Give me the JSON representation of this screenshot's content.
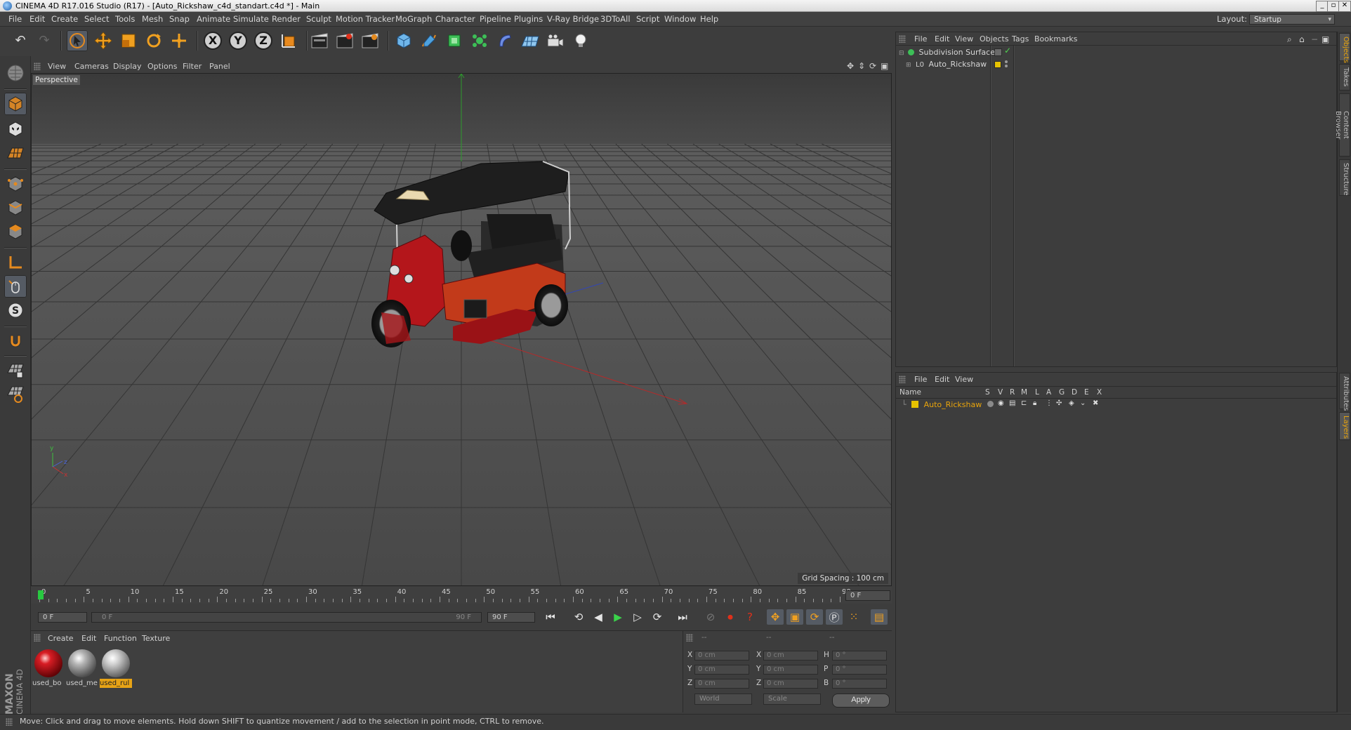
{
  "window": {
    "title": "CINEMA 4D R17.016 Studio (R17) - [Auto_Rickshaw_c4d_standart.c4d *] - Main"
  },
  "menubar": {
    "items": [
      "File",
      "Edit",
      "Create",
      "Select",
      "Tools",
      "Mesh",
      "Snap",
      "Animate",
      "Simulate",
      "Render",
      "Sculpt",
      "Motion Tracker",
      "MoGraph",
      "Character",
      "Pipeline",
      "Plugins",
      "V-Ray Bridge",
      "3DToAll",
      "Script",
      "Window",
      "Help"
    ],
    "layout_label": "Layout:",
    "layout_value": "Startup"
  },
  "viewport": {
    "menu": [
      "View",
      "Cameras",
      "Display",
      "Options",
      "Filter",
      "Panel"
    ],
    "label": "Perspective",
    "grid_spacing": "Grid Spacing : 100 cm"
  },
  "timeline": {
    "ticks": [
      "0",
      "5",
      "10",
      "15",
      "20",
      "25",
      "30",
      "35",
      "40",
      "45",
      "50",
      "55",
      "60",
      "65",
      "70",
      "75",
      "80",
      "85",
      "90"
    ],
    "current_frame": "0 F",
    "start_frame": "0 F",
    "range_start": "0 F",
    "range_end": "90 F",
    "end_frame": "90 F"
  },
  "materials": {
    "menu": [
      "Create",
      "Edit",
      "Function",
      "Texture"
    ],
    "items": [
      {
        "label": "used_bo",
        "color": "#c8141a",
        "selected": false
      },
      {
        "label": "used_me",
        "color": "#9a9a9a",
        "selected": false
      },
      {
        "label": "used_rul",
        "color": "#b5b5b5",
        "selected": true
      }
    ]
  },
  "coords": {
    "header": [
      "--",
      "--",
      "--"
    ],
    "rows": [
      {
        "l1": "X",
        "v1": "0 cm",
        "l2": "X",
        "v2": "0 cm",
        "l3": "H",
        "v3": "0 °"
      },
      {
        "l1": "Y",
        "v1": "0 cm",
        "l2": "Y",
        "v2": "0 cm",
        "l3": "P",
        "v3": "0 °"
      },
      {
        "l1": "Z",
        "v1": "0 cm",
        "l2": "Z",
        "v2": "0 cm",
        "l3": "B",
        "v3": "0 °"
      }
    ],
    "space": "World",
    "mode": "Scale",
    "apply": "Apply"
  },
  "object_manager": {
    "menu": [
      "File",
      "Edit",
      "View",
      "Objects",
      "Tags",
      "Bookmarks"
    ],
    "rows": [
      {
        "name": "Subdivision Surface"
      },
      {
        "name": "Auto_Rickshaw"
      }
    ]
  },
  "layer_manager": {
    "menu": [
      "File",
      "Edit",
      "View"
    ],
    "columns": [
      "Name",
      "S",
      "V",
      "R",
      "M",
      "L",
      "A",
      "G",
      "D",
      "E",
      "X"
    ],
    "rows": [
      {
        "name": "Auto_Rickshaw",
        "color": "#e6c200"
      }
    ]
  },
  "side_tabs": [
    "Objects",
    "Takes",
    "Content Browser",
    "Structure",
    "Attributes",
    "Layers"
  ],
  "logo": {
    "line1": "MAXON",
    "line2": "CINEMA 4D"
  },
  "status": "Move: Click and drag to move elements. Hold down SHIFT to quantize movement / add to the selection in point mode, CTRL to remove.",
  "colors": {
    "accent": "#e7a316",
    "selection": "#e6c200",
    "layer_name": "#e8a40c"
  }
}
